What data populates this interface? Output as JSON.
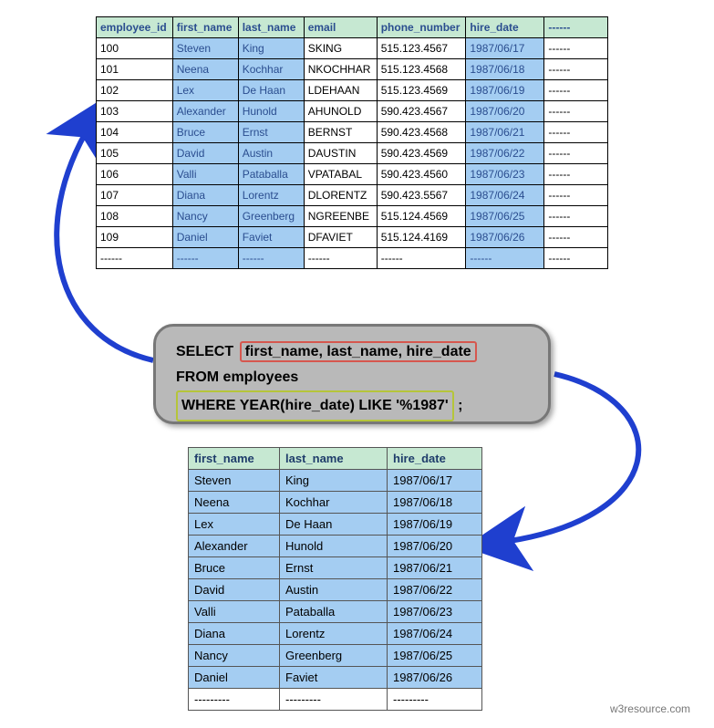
{
  "top": {
    "headers": [
      "employee_id",
      "first_name",
      "last_name",
      "email",
      "phone_number",
      "hire_date",
      "------"
    ],
    "rows": [
      [
        "100",
        "Steven",
        "King",
        "SKING",
        "515.123.4567",
        "1987/06/17",
        "------"
      ],
      [
        "101",
        "Neena",
        "Kochhar",
        "NKOCHHAR",
        "515.123.4568",
        "1987/06/18",
        "------"
      ],
      [
        "102",
        "Lex",
        "De Haan",
        "LDEHAAN",
        "515.123.4569",
        "1987/06/19",
        "------"
      ],
      [
        "103",
        "Alexander",
        "Hunold",
        "AHUNOLD",
        "590.423.4567",
        "1987/06/20",
        "------"
      ],
      [
        "104",
        "Bruce",
        "Ernst",
        "BERNST",
        "590.423.4568",
        "1987/06/21",
        "------"
      ],
      [
        "105",
        "David",
        "Austin",
        "DAUSTIN",
        "590.423.4569",
        "1987/06/22",
        "------"
      ],
      [
        "106",
        "Valli",
        "Pataballa",
        "VPATABAL",
        "590.423.4560",
        "1987/06/23",
        "------"
      ],
      [
        "107",
        "Diana",
        "Lorentz",
        "DLORENTZ",
        "590.423.5567",
        "1987/06/24",
        "------"
      ],
      [
        "108",
        "Nancy",
        "Greenberg",
        "NGREENBE",
        "515.124.4569",
        "1987/06/25",
        "------"
      ],
      [
        "109",
        "Daniel",
        "Faviet",
        "DFAVIET",
        "515.124.4169",
        "1987/06/26",
        "------"
      ],
      [
        "------",
        "------",
        "------",
        "------",
        "------",
        "------",
        "------"
      ]
    ]
  },
  "sql": {
    "kw_select": "SELECT",
    "cols": "first_name, last_name, hire_date",
    "from": "FROM employees",
    "where": "WHERE YEAR(hire_date)  LIKE '%1987'",
    "semi": " ;"
  },
  "bottom": {
    "headers": [
      "first_name",
      "last_name",
      "hire_date"
    ],
    "rows": [
      [
        "Steven",
        "King",
        "1987/06/17"
      ],
      [
        "Neena",
        "Kochhar",
        "1987/06/18"
      ],
      [
        "Lex",
        "De Haan",
        "1987/06/19"
      ],
      [
        "Alexander",
        "Hunold",
        "1987/06/20"
      ],
      [
        "Bruce",
        "Ernst",
        "1987/06/21"
      ],
      [
        "David",
        "Austin",
        "1987/06/22"
      ],
      [
        "Valli",
        "Pataballa",
        "1987/06/23"
      ],
      [
        "Diana",
        "Lorentz",
        "1987/06/24"
      ],
      [
        "Nancy",
        "Greenberg",
        "1987/06/25"
      ],
      [
        "Daniel",
        "Faviet",
        "1987/06/26"
      ],
      [
        "---------",
        "---------",
        "---------"
      ]
    ]
  },
  "credit": "w3resource.com"
}
